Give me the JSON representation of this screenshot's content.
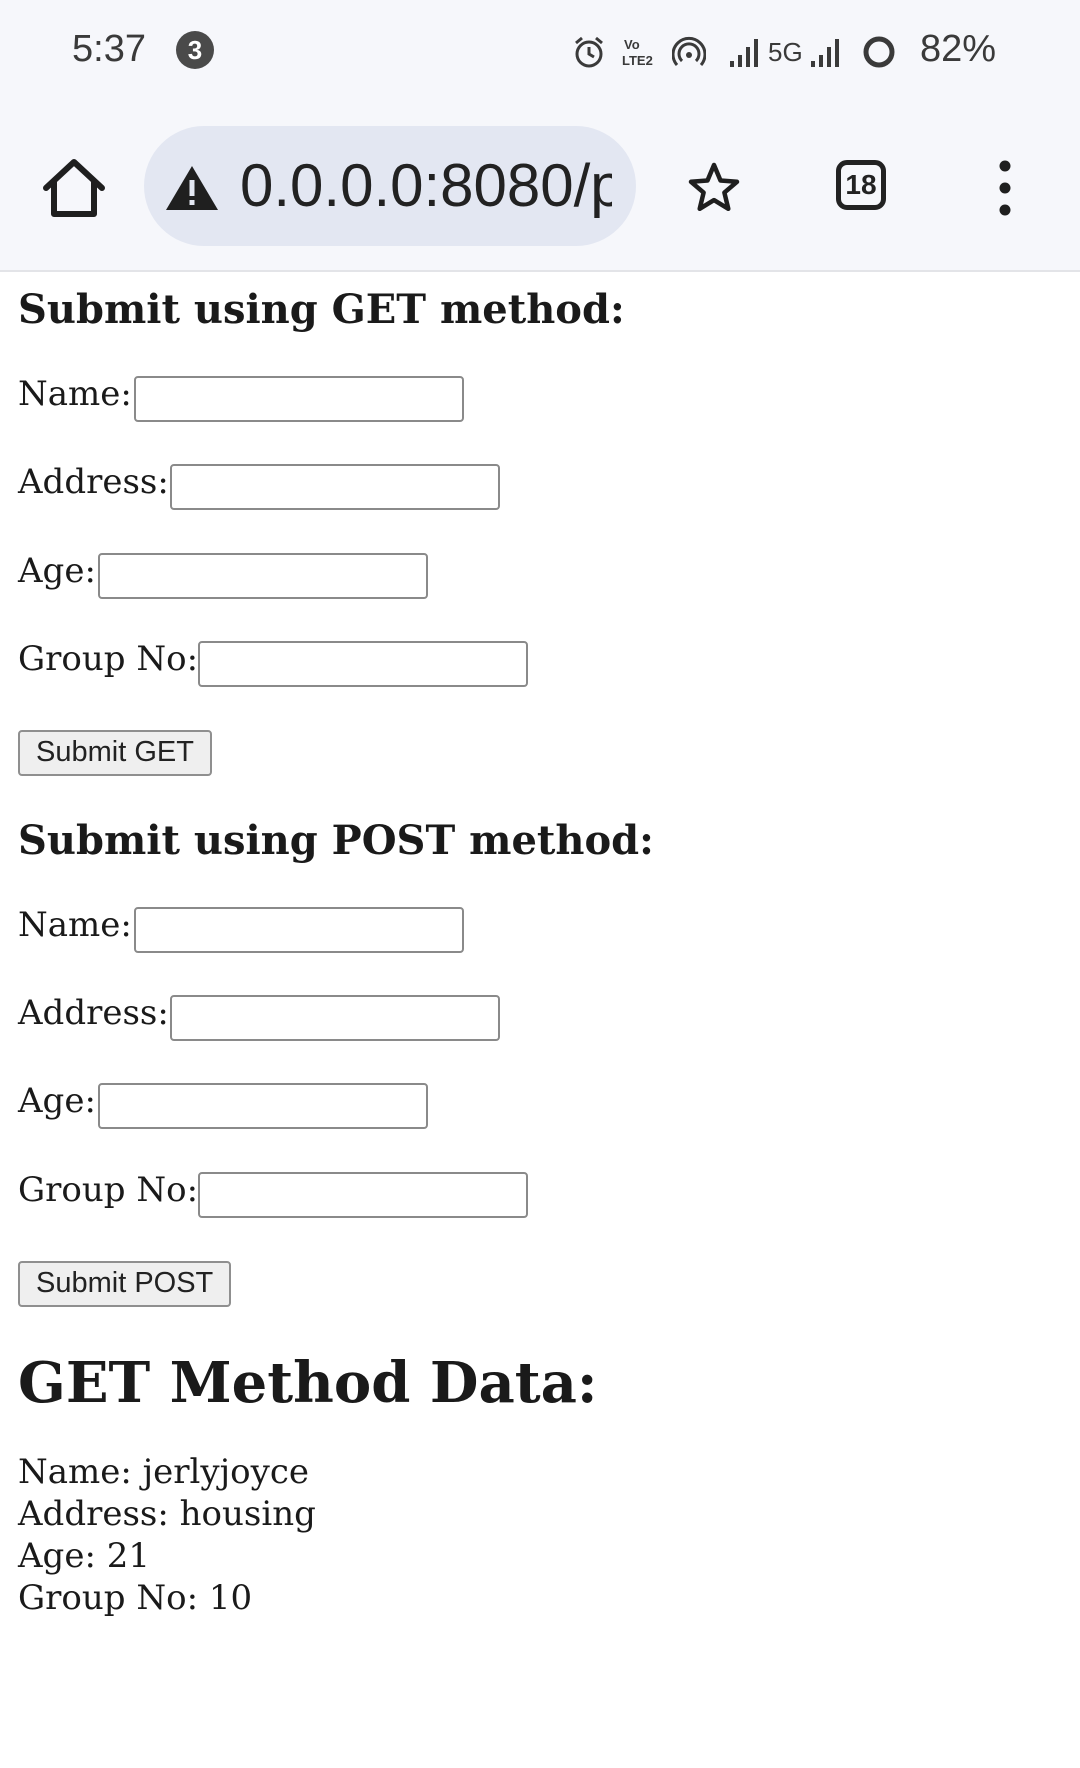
{
  "status_bar": {
    "time": "5:37",
    "notification_count": "3",
    "icons": [
      "alarm-icon",
      "volte-icon",
      "hotspot-icon",
      "signal-icon",
      "5g-icon",
      "signal-icon",
      "battery-ring-icon"
    ],
    "network": "5G",
    "battery": "82%"
  },
  "browser": {
    "url": "0.0.0.0:8080/p",
    "tab_count": "18",
    "icons": [
      "home-icon",
      "warning-icon",
      "star-icon",
      "tabs-icon",
      "more-vert-icon"
    ]
  },
  "get_form": {
    "title": "Submit using GET method:",
    "fields": [
      {
        "label": "Name:",
        "value": ""
      },
      {
        "label": "Address:",
        "value": ""
      },
      {
        "label": "Age:",
        "value": ""
      },
      {
        "label": "Group No:",
        "value": ""
      }
    ],
    "submit_label": "Submit GET"
  },
  "post_form": {
    "title": "Submit using POST method:",
    "fields": [
      {
        "label": "Name:",
        "value": ""
      },
      {
        "label": "Address:",
        "value": ""
      },
      {
        "label": "Age:",
        "value": ""
      },
      {
        "label": "Group No:",
        "value": ""
      }
    ],
    "submit_label": "Submit POST"
  },
  "get_data": {
    "title": "GET Method Data:",
    "lines": [
      "Name: jerlyjoyce",
      "Address: housing",
      "Age: 21",
      "Group No: 10"
    ]
  }
}
